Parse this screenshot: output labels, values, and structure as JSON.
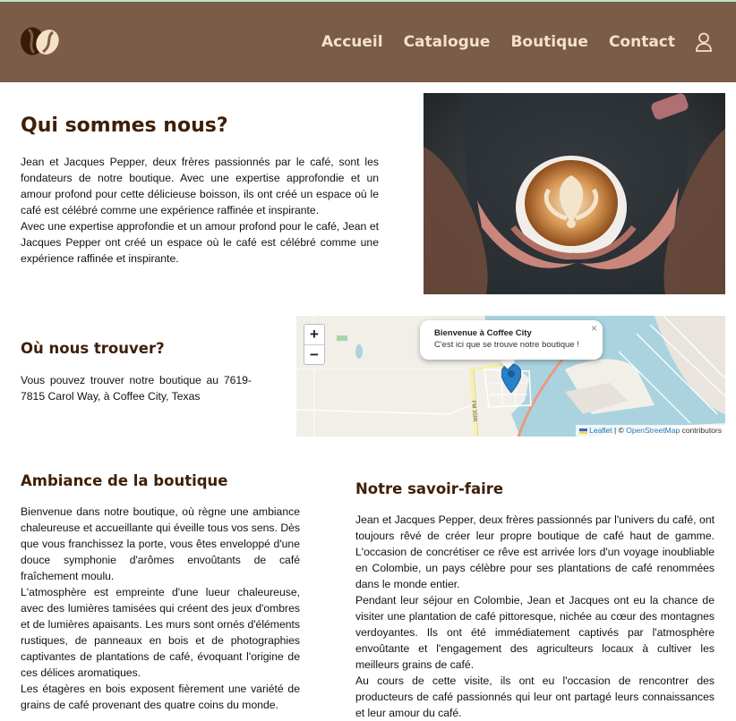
{
  "nav": {
    "items": [
      "Accueil",
      "Catalogue",
      "Boutique",
      "Contact"
    ]
  },
  "about": {
    "title": "Qui sommes nous?",
    "paragraphs": [
      "Jean et Jacques Pepper, deux frères passionnés par le café, sont les fondateurs de notre boutique. Avec une expertise approfondie et un amour profond pour cette délicieuse boisson, ils ont créé un espace où le café est célébré comme une expérience raffinée et inspirante.",
      "Avec une expertise approfondie et un amour profond pour le café, Jean et Jacques Pepper ont créé un espace où le café est célébré comme une expérience raffinée et inspirante."
    ]
  },
  "location": {
    "title": "Où nous trouver?",
    "text": "Vous pouvez trouver notre boutique au 7619-7815 Carol Way, à Coffee City, Texas"
  },
  "map": {
    "zoom_in": "+",
    "zoom_out": "−",
    "popup_title": "Bienvenue à Coffee City",
    "popup_text": "C'est ici que se trouve notre boutique !",
    "popup_close": "×",
    "attribution_leaflet": "Leaflet",
    "attribution_sep": " | © ",
    "attribution_osm": "OpenStreetMap",
    "attribution_suffix": " contributors",
    "road_label": "FM 3506"
  },
  "ambiance": {
    "title": "Ambiance de la boutique",
    "paragraphs": [
      "Bienvenue dans notre boutique, où règne une ambiance chaleureuse et accueillante qui éveille tous vos sens. Dès que vous franchissez la porte, vous êtes enveloppé d'une douce symphonie d'arômes envoûtants de café fraîchement moulu.",
      "L'atmosphère est empreinte d'une lueur chaleureuse, avec des lumières tamisées qui créent des jeux d'ombres et de lumières apaisants. Les murs sont ornés d'éléments rustiques, de panneaux en bois et de photographies captivantes de plantations de café, évoquant l'origine de ces délices aromatiques.",
      "Les étagères en bois exposent fièrement une variété de grains de café provenant des quatre coins du monde."
    ]
  },
  "savoirfaire": {
    "title": "Notre savoir-faire",
    "paragraphs": [
      "Jean et Jacques Pepper, deux frères passionnés par l'univers du café, ont toujours rêvé de créer leur propre boutique de café haut de gamme. L'occasion de concrétiser ce rêve est arrivée lors d'un voyage inoubliable en Colombie, un pays célèbre pour ses plantations de café renommées dans le monde entier.",
      "Pendant leur séjour en Colombie, Jean et Jacques ont eu la chance de visiter une plantation de café pittoresque, nichée au cœur des montagnes verdoyantes. Ils ont été immédiatement captivés par l'atmosphère envoûtante et l'engagement des agriculteurs locaux à cultiver les meilleurs grains de café.",
      "Au cours de cette visite, ils ont eu l'occasion de rencontrer des producteurs de café passionnés qui leur ont partagé leurs connaissances et leur amour du café."
    ]
  },
  "colors": {
    "header_bg": "#7b5c48",
    "nav_text": "#f4e2c6",
    "heading": "#3f1f06"
  },
  "icons": {
    "logo": "coffee-bean-logo",
    "user": "user-icon",
    "marker": "map-marker-icon"
  }
}
